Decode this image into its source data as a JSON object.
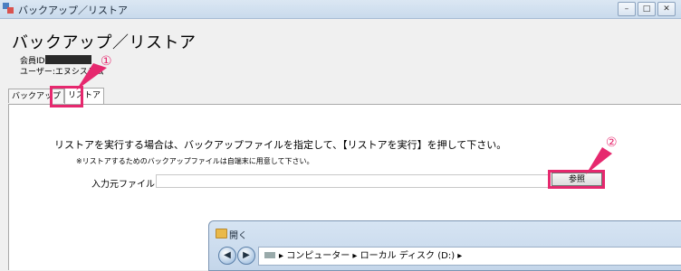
{
  "window": {
    "title": "バックアップ／リストア",
    "min": "–",
    "max": "□",
    "close": "✕"
  },
  "header": {
    "heading": "バックアップ／リストア",
    "member_label": "会員ID",
    "user_line": "ユーザー:エヌシステム"
  },
  "tabs": [
    {
      "label": "バックアップ"
    },
    {
      "label": "リストア"
    }
  ],
  "annotations": {
    "one": "①",
    "two": "②",
    "color": "#e6286e"
  },
  "restore": {
    "instruction": "リストアを実行する場合は、バックアップファイルを指定して、【リストアを実行】を押して下さい。",
    "note": "※リストアするためのバックアップファイルは自端末に用意して下さい。",
    "source_label": "入力元ファイル",
    "source_value": "",
    "browse_label": "参照"
  },
  "open_dialog": {
    "title": "開く",
    "back": "◀",
    "forward": "▶",
    "path": "▸ コンピューター ▸ ローカル ディスク (D:) ▸"
  }
}
